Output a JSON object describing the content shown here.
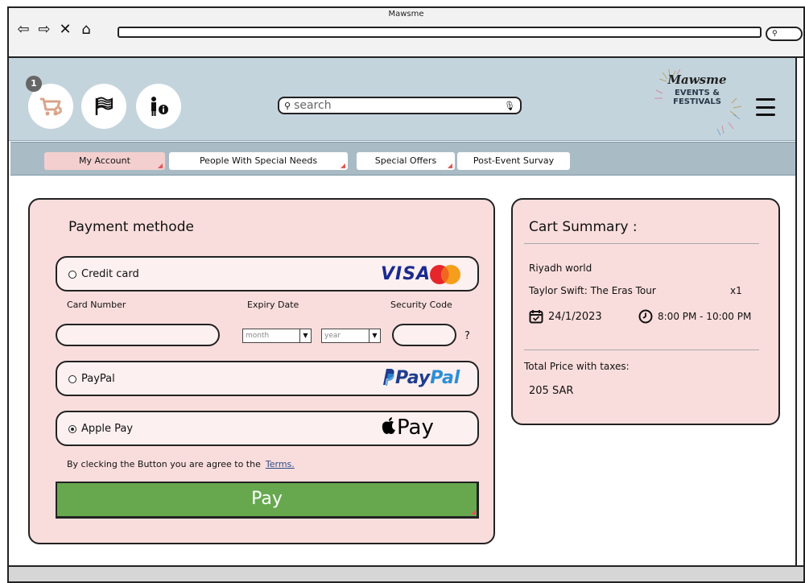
{
  "window": {
    "title": "Mawsme"
  },
  "address_bar": {
    "search_button": ""
  },
  "header": {
    "cart_badge": "1",
    "search_placeholder": "search",
    "logo": {
      "line1": "Mawsme",
      "line2": "EVENTS &",
      "line3": "FESTIVALS"
    }
  },
  "nav": {
    "tabs": [
      {
        "label": "My Account",
        "active": true
      },
      {
        "label": "People With Special Needs",
        "active": false
      },
      {
        "label": "Special Offers",
        "active": false
      },
      {
        "label": "Post-Event Survay",
        "active": false
      }
    ]
  },
  "payment": {
    "title": "Payment methode",
    "methods": [
      {
        "label": "Credit card",
        "brand": "VISA",
        "selected": false
      },
      {
        "label": "PayPal",
        "brand_a": "Pay",
        "brand_b": "Pal",
        "selected": false
      },
      {
        "label": "Apple Pay",
        "brand": "Pay",
        "selected": true
      }
    ],
    "card_number_label": "Card Number",
    "expiry_label": "Expiry Date",
    "security_label": "Security Code",
    "month_placeholder": "month",
    "year_placeholder": "year",
    "security_help": "?",
    "terms_text": "By clecking the Button you are agree to the",
    "terms_link": "Terms.",
    "pay_button": "Pay"
  },
  "cart": {
    "title": "Cart Summary :",
    "venue": "Riyadh world",
    "event": "Taylor Swift: The Eras Tour",
    "quantity": "x1",
    "date": "24/1/2023",
    "time": "8:00 PM - 10:00 PM",
    "total_label": "Total Price with taxes:",
    "total_value": "205 SAR"
  },
  "colors": {
    "header_bg": "#c4d4dd",
    "navbar_bg": "#a9bcc6",
    "panel_bg": "#f9dddc",
    "pay_button": "#67a84f",
    "active_tab": "#f4cfcf"
  }
}
